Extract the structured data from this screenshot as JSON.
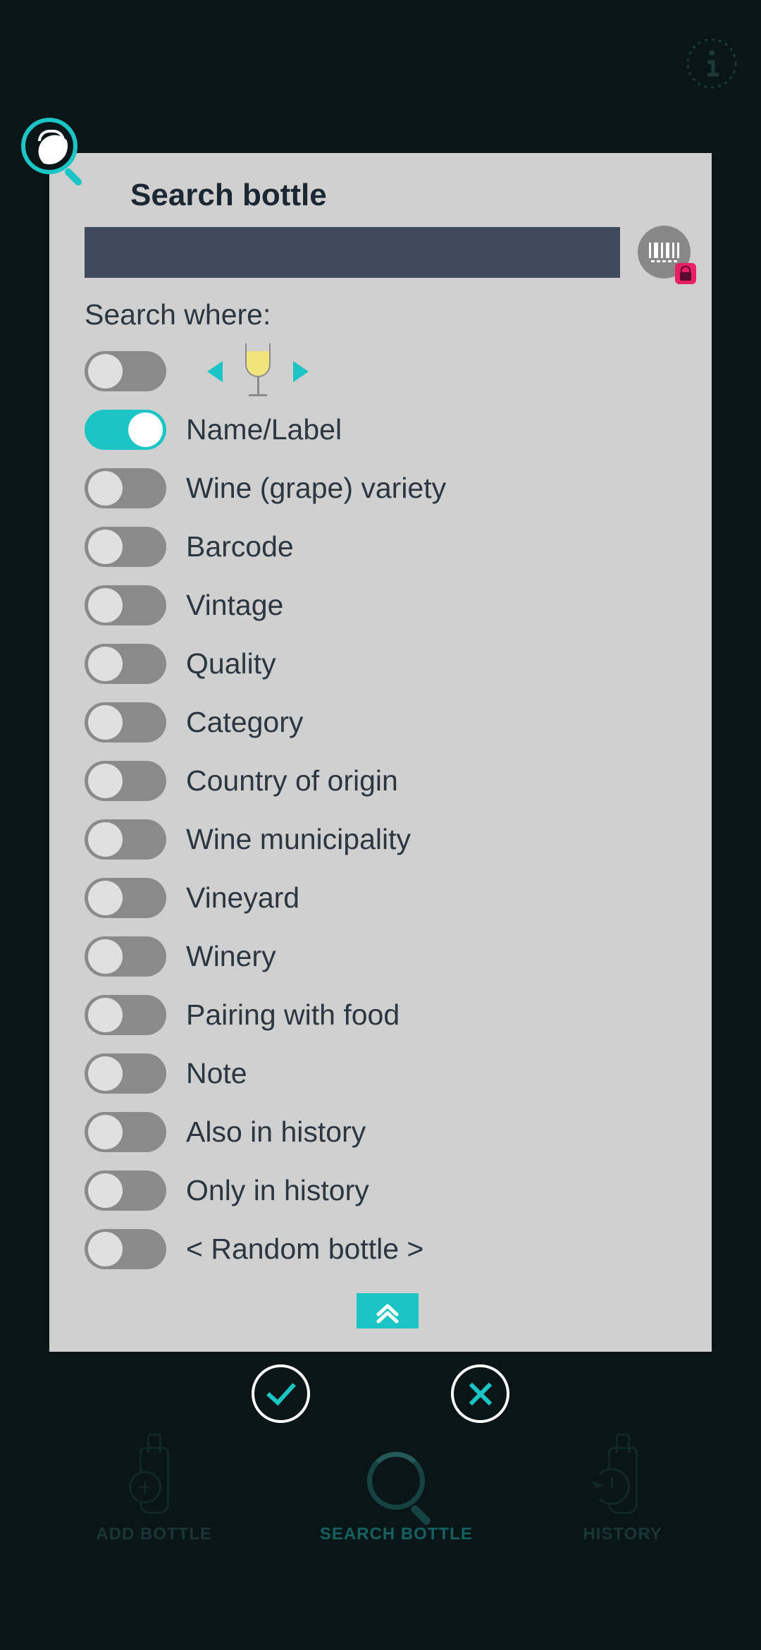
{
  "header": {
    "info_icon": "info"
  },
  "modal": {
    "title": "Search bottle",
    "search_value": "",
    "section_label": "Search where:",
    "filters": [
      {
        "label": "",
        "on": false,
        "is_wine_type": true
      },
      {
        "label": "Name/Label",
        "on": true
      },
      {
        "label": "Wine (grape) variety",
        "on": false
      },
      {
        "label": "Barcode",
        "on": false
      },
      {
        "label": "Vintage",
        "on": false
      },
      {
        "label": "Quality",
        "on": false
      },
      {
        "label": "Category",
        "on": false
      },
      {
        "label": "Country of origin",
        "on": false
      },
      {
        "label": "Wine municipality",
        "on": false
      },
      {
        "label": "Vineyard",
        "on": false
      },
      {
        "label": "Winery",
        "on": false
      },
      {
        "label": "Pairing with food",
        "on": false
      },
      {
        "label": "Note",
        "on": false
      },
      {
        "label": "Also in history",
        "on": false
      },
      {
        "label": "Only in history",
        "on": false
      },
      {
        "label": "< Random bottle >",
        "on": false
      }
    ]
  },
  "actions": {
    "confirm": "confirm",
    "cancel": "cancel"
  },
  "nav": {
    "add": "ADD BOTTLE",
    "search": "SEARCH BOTTLE",
    "history": "HISTORY"
  },
  "colors": {
    "accent": "#1bc5c5",
    "panel": "#d0d0d0",
    "input": "#3e4a5c",
    "text": "#2b3640",
    "lock": "#e91e63"
  }
}
